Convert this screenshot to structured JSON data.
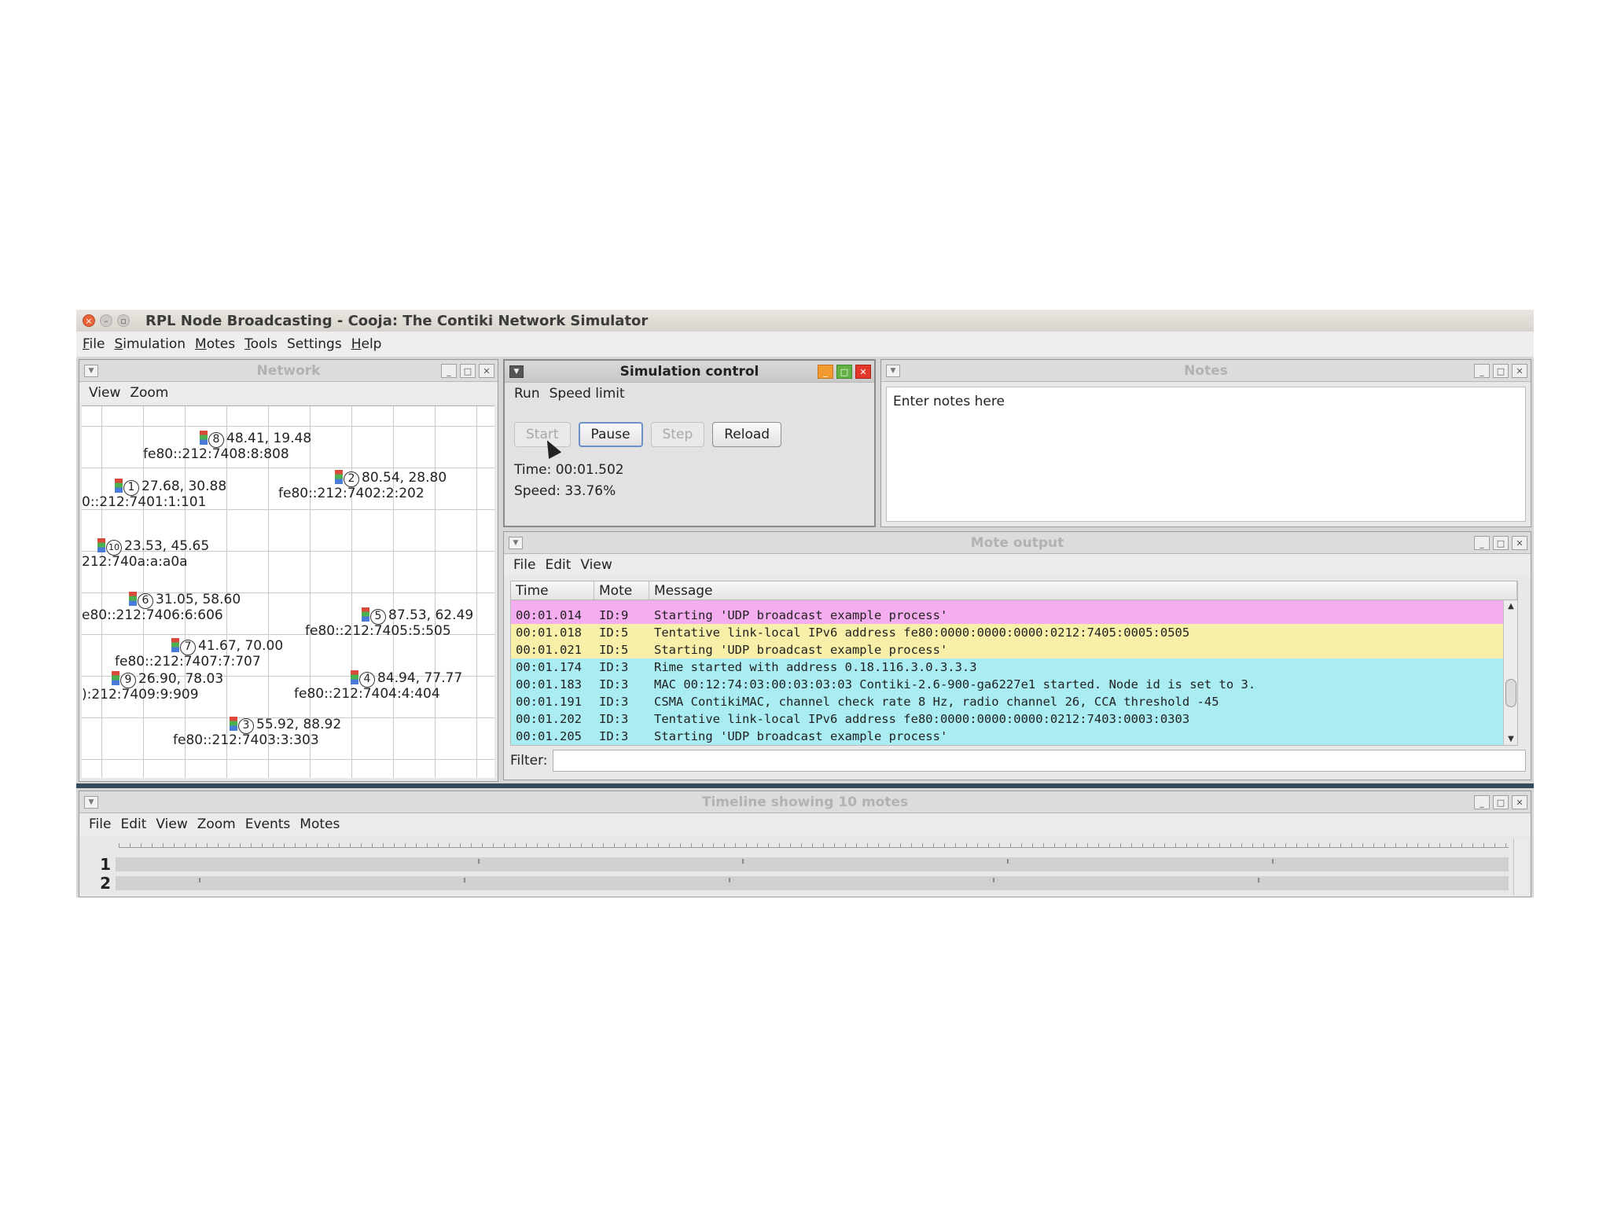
{
  "window": {
    "title": "RPL Node Broadcasting - Cooja: The Contiki Network Simulator"
  },
  "menubar": [
    {
      "label": "File",
      "underline": "F",
      "rest": "ile"
    },
    {
      "label": "Simulation",
      "underline": "S",
      "rest": "imulation"
    },
    {
      "label": "Motes",
      "underline": "M",
      "rest": "otes"
    },
    {
      "label": "Tools",
      "underline": "T",
      "rest": "ools"
    },
    {
      "label": "Settings",
      "underline": "",
      "rest": "Settings"
    },
    {
      "label": "Help",
      "underline": "H",
      "rest": "elp"
    }
  ],
  "network": {
    "title": "Network",
    "menu": [
      "View",
      "Zoom"
    ],
    "motes": [
      {
        "id": "8",
        "coords": "48.41, 19.48",
        "address": "fe80::212:7408:8:808"
      },
      {
        "id": "2",
        "coords": "80.54, 28.80",
        "address": "fe80::212:7402:2:202"
      },
      {
        "id": "1",
        "coords": "27.68, 30.88",
        "address": "0::212:7401:1:101"
      },
      {
        "id": "10",
        "coords": "23.53, 45.65",
        "address": "212:740a:a:a0a"
      },
      {
        "id": "6",
        "coords": "31.05, 58.60",
        "address": "e80::212:7406:6:606"
      },
      {
        "id": "5",
        "coords": "87.53, 62.49",
        "address": "fe80::212:7405:5:505"
      },
      {
        "id": "7",
        "coords": "41.67, 70.00",
        "address": "fe80::212:7407:7:707"
      },
      {
        "id": "9",
        "coords": "26.90, 78.03",
        "address": "):212:7409:9:909"
      },
      {
        "id": "4",
        "coords": "84.94, 77.77",
        "address": "fe80::212:7404:4:404"
      },
      {
        "id": "3",
        "coords": "55.92, 88.92",
        "address": "fe80::212:7403:3:303"
      }
    ]
  },
  "simulation_control": {
    "title": "Simulation control",
    "menu": [
      "Run",
      "Speed limit"
    ],
    "buttons": {
      "start": "Start",
      "pause": "Pause",
      "step": "Step",
      "reload": "Reload"
    },
    "time": "Time: 00:01.502",
    "speed": "Speed: 33.76%"
  },
  "notes": {
    "title": "Notes",
    "text": "Enter notes here"
  },
  "mote_output": {
    "title": "Mote output",
    "menu": [
      "File",
      "Edit",
      "View"
    ],
    "columns": [
      "Time",
      "Mote",
      "Message"
    ],
    "rows": [
      {
        "time": "00:01.014",
        "mote": "ID:9",
        "message": "Starting 'UDP broadcast example process'",
        "color": "#f4aef0"
      },
      {
        "time": "00:01.018",
        "mote": "ID:5",
        "message": "Tentative link-local IPv6 address fe80:0000:0000:0000:0212:7405:0005:0505",
        "color": "#f8f0a8"
      },
      {
        "time": "00:01.021",
        "mote": "ID:5",
        "message": "Starting 'UDP broadcast example process'",
        "color": "#f8f0a8"
      },
      {
        "time": "00:01.174",
        "mote": "ID:3",
        "message": "Rime started with address 0.18.116.3.0.3.3.3",
        "color": "#a9ecf2"
      },
      {
        "time": "00:01.183",
        "mote": "ID:3",
        "message": "MAC 00:12:74:03:00:03:03:03 Contiki-2.6-900-ga6227e1 started. Node id is set to 3.",
        "color": "#a9ecf2"
      },
      {
        "time": "00:01.191",
        "mote": "ID:3",
        "message": "CSMA ContikiMAC, channel check rate 8 Hz, radio channel 26, CCA threshold -45",
        "color": "#a9ecf2"
      },
      {
        "time": "00:01.202",
        "mote": "ID:3",
        "message": "Tentative link-local IPv6 address fe80:0000:0000:0000:0212:7403:0003:0303",
        "color": "#a9ecf2"
      },
      {
        "time": "00:01.205",
        "mote": "ID:3",
        "message": "Starting 'UDP broadcast example process'",
        "color": "#a9ecf2"
      }
    ],
    "filter_label": "Filter:",
    "filter_value": ""
  },
  "timeline": {
    "title": "Timeline showing 10 motes",
    "menu": [
      "File",
      "Edit",
      "View",
      "Zoom",
      "Events",
      "Motes"
    ],
    "rows": [
      "1",
      "2"
    ]
  }
}
